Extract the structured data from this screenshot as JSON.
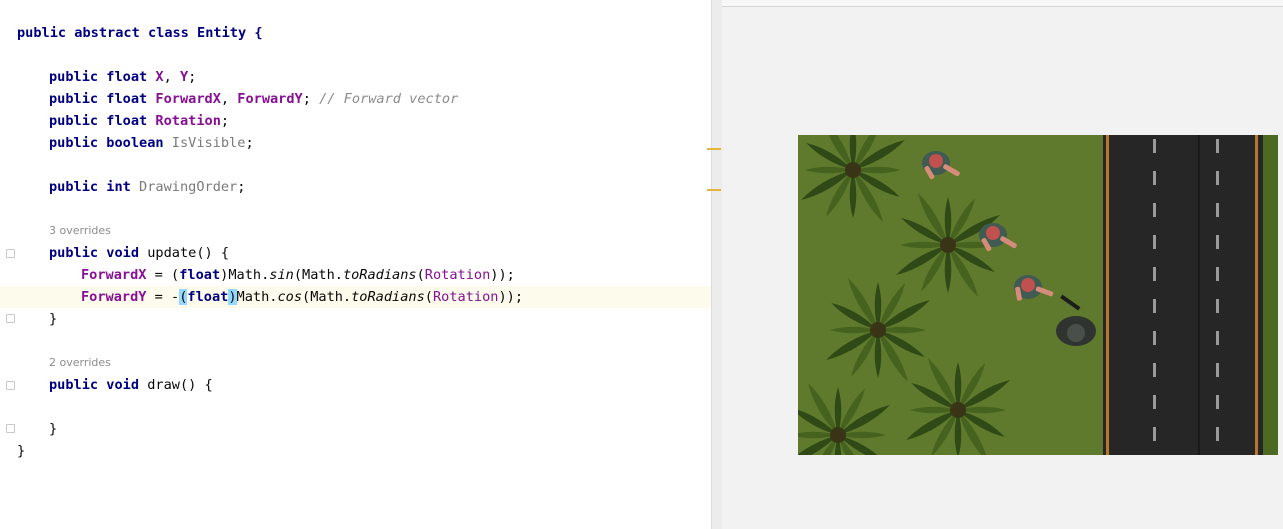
{
  "code": {
    "line1": "public abstract class Entity {",
    "line3_kw": "public float ",
    "line3_x": "X",
    "line3_sep": ", ",
    "line3_y": "Y",
    "line3_end": ";",
    "line4_kw": "public float ",
    "line4_fx": "ForwardX",
    "line4_sep": ", ",
    "line4_fy": "ForwardY",
    "line4_semi": "; ",
    "line4_comment": "// Forward vector",
    "line5_kw": "public float ",
    "line5_rot": "Rotation",
    "line5_end": ";",
    "line6_kw": "public boolean ",
    "line6_vis": "IsVisible",
    "line6_end": ";",
    "line8_kw": "public int ",
    "line8_draw": "DrawingOrder",
    "line8_end": ";",
    "hint_update": "3 overrides",
    "line10_kw": "public void ",
    "line10_rest": "update() {",
    "line11_fx": "ForwardX",
    "line11_a": " = (",
    "line11_float": "float",
    "line11_b": ")Math.",
    "line11_sin": "sin",
    "line11_c": "(Math.",
    "line11_torad": "toRadians",
    "line11_d": "(",
    "line11_rot": "Rotation",
    "line11_e": "));",
    "line12_fy": "ForwardY",
    "line12_a": " = -",
    "line12_paren1": "(",
    "line12_float": "float",
    "line12_paren2": ")",
    "line12_b": "Math.",
    "line12_cos": "cos",
    "line12_c": "(Math.",
    "line12_torad": "toRadians",
    "line12_d": "(",
    "line12_rot": "Rotation",
    "line12_e": "));",
    "line13": "}",
    "hint_draw": "2 overrides",
    "line15_kw": "public void ",
    "line15_rest": "draw() {",
    "line17": "}",
    "line18": "}"
  },
  "colors": {
    "keyword": "#0033b3",
    "field": "#871094",
    "comment": "#8c8c8c",
    "current_line": "#fdfbeb",
    "bracket_match": "#93d9ff",
    "grass": "#5f7a2c",
    "road": "#262626"
  }
}
